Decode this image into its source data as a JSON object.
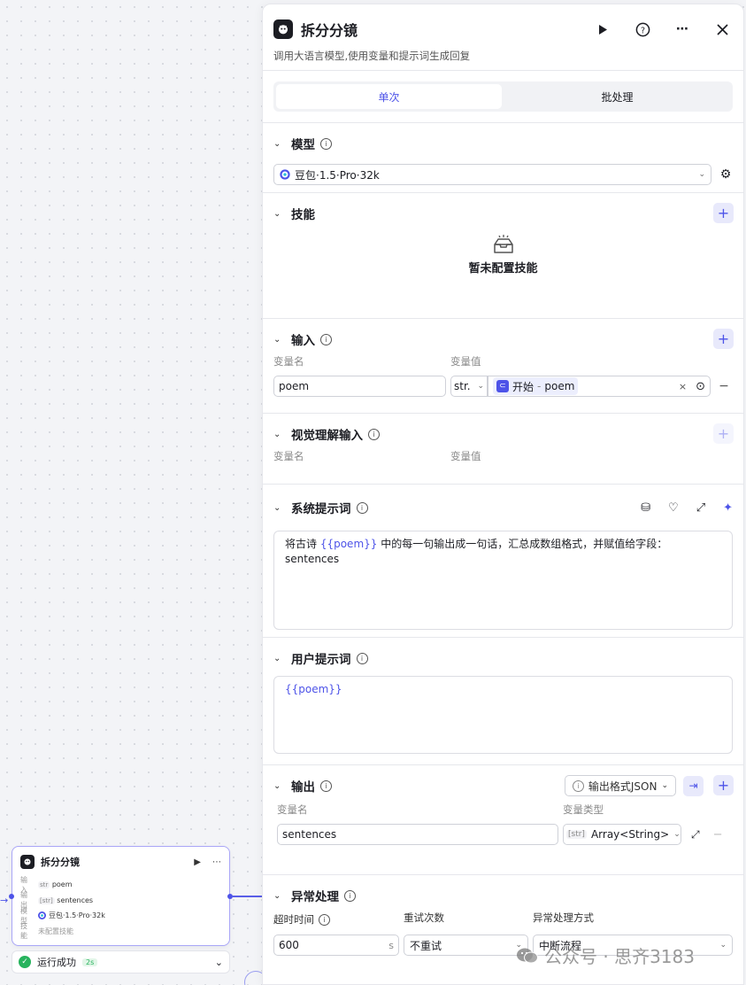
{
  "canvas": {
    "node": {
      "title": "拆分分镜",
      "rows": [
        {
          "key": "输入",
          "tag": "str",
          "value": "poem"
        },
        {
          "key": "输出",
          "tag": "[str]",
          "value": "sentences"
        },
        {
          "key": "模型",
          "tag": "",
          "value": "豆包·1.5·Pro·32k"
        },
        {
          "key": "技能",
          "tag": "",
          "value": "未配置技能"
        }
      ]
    },
    "status": {
      "text": "运行成功",
      "duration": "2s"
    }
  },
  "panel": {
    "title": "拆分分镜",
    "description": "调用大语言模型,使用变量和提示词生成回复",
    "mode_tabs": [
      {
        "label": "单次",
        "active": true
      },
      {
        "label": "批处理",
        "active": false
      }
    ],
    "model": {
      "title": "模型",
      "selected": "豆包·1.5·Pro·32k"
    },
    "skills": {
      "title": "技能",
      "empty_text": "暂未配置技能"
    },
    "input": {
      "title": "输入",
      "col_name": "变量名",
      "col_value": "变量值",
      "rows": [
        {
          "name": "poem",
          "type": "str.",
          "ref_source": "开始",
          "ref_sep": "-",
          "ref_var": "poem"
        }
      ]
    },
    "vision_input": {
      "title": "视觉理解输入",
      "col_name": "变量名",
      "col_value": "变量值"
    },
    "system_prompt": {
      "title": "系统提示词",
      "text_before": "将古诗 ",
      "var": "{{poem}}",
      "text_after": " 中的每一句输出成一句话，汇总成数组格式，并赋值给字段：sentences"
    },
    "user_prompt": {
      "title": "用户提示词",
      "var": "{{poem}}"
    },
    "output": {
      "title": "输出",
      "format_label": "输出格式JSON",
      "col_name": "变量名",
      "col_type": "变量类型",
      "rows": [
        {
          "name": "sentences",
          "type_tag": "[str]",
          "type": "Array<String>"
        }
      ]
    },
    "exception": {
      "title": "异常处理",
      "timeout_label": "超时时间",
      "timeout_value": "600",
      "timeout_unit": "s",
      "retry_label": "重试次数",
      "retry_value": "不重试",
      "method_label": "异常处理方式",
      "method_value": "中断流程"
    }
  },
  "watermark": {
    "text": "公众号 · 思齐3183"
  },
  "colors": {
    "accent": "#4d53e8",
    "success": "#27b35d"
  }
}
